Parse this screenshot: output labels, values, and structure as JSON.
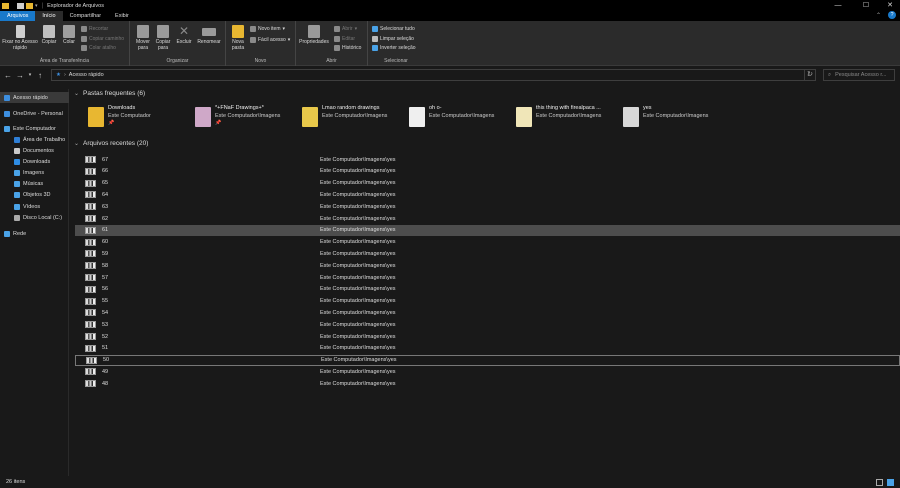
{
  "window": {
    "title": "Explorador de Arquivos",
    "minimize": "—",
    "maximize": "☐",
    "close": "✕"
  },
  "tabs": [
    "Arquivos",
    "Início",
    "Compartilhar",
    "Exibir"
  ],
  "ribbon": {
    "clipboard": {
      "label": "Área de Transferência",
      "pin": "Fixar no Acesso rápido",
      "copy": "Copiar",
      "paste": "Colar",
      "cut": "Recortar",
      "copy_path": "Copiar caminho",
      "paste_shortcut": "Colar atalho"
    },
    "organize": {
      "label": "Organizar",
      "move": "Mover para",
      "copy_to": "Copiar para",
      "delete": "Excluir",
      "rename": "Renomear"
    },
    "new": {
      "label": "Novo",
      "new_folder": "Nova pasta",
      "new_item": "Novo item",
      "easy_access": "Fácil acesso"
    },
    "open": {
      "label": "Abrir",
      "properties": "Propriedades",
      "open": "Abrir",
      "edit": "Editar",
      "history": "Histórico"
    },
    "select": {
      "label": "Selecionar",
      "select_all": "Selecionar tudo",
      "clear": "Limpar seleção",
      "invert": "Inverter seleção"
    }
  },
  "address": {
    "path": "Acesso rápido",
    "search_placeholder": "Pesquisar Acesso r..."
  },
  "nav": [
    {
      "label": "Acesso rápido",
      "color": "#3d8fe0"
    },
    {
      "label": "OneDrive - Personal",
      "color": "#3d8fe0"
    },
    {
      "label": "Este Computador",
      "color": "#4aa3e8"
    },
    {
      "label": "Área de Trabalho",
      "color": "#2f7fd6"
    },
    {
      "label": "Documentos",
      "color": "#c9c9c9"
    },
    {
      "label": "Downloads",
      "color": "#2f8de4"
    },
    {
      "label": "Imagens",
      "color": "#4aa3e8"
    },
    {
      "label": "Músicas",
      "color": "#4aa3e8"
    },
    {
      "label": "Objetos 3D",
      "color": "#4aa3e8"
    },
    {
      "label": "Vídeos",
      "color": "#4aa3e8"
    },
    {
      "label": "Disco Local (C:)",
      "color": "#aaaaaa"
    },
    {
      "label": "Rede",
      "color": "#4aa3e8"
    }
  ],
  "frequent": {
    "header": "Pastas frequentes (6)",
    "items": [
      {
        "name": "Downloads",
        "path": "Este Computador",
        "pin": "📌"
      },
      {
        "name": "*+FNaF Drawings+*",
        "path": "Este Computador\\Imagens",
        "pin": "📌"
      },
      {
        "name": "Lmao random drawings",
        "path": "Este Computador\\Imagens",
        "pin": ""
      },
      {
        "name": "oh o-",
        "path": "Este Computador\\Imagens",
        "pin": ""
      },
      {
        "name": "this thing with firealpaca ...",
        "path": "Este Computador\\Imagens",
        "pin": ""
      },
      {
        "name": "yes",
        "path": "Este Computador\\Imagens",
        "pin": ""
      }
    ]
  },
  "recent": {
    "header": "Arquivos recentes (20)",
    "items": [
      {
        "name": "67",
        "path": "Este Computador\\Imagens\\yes"
      },
      {
        "name": "66",
        "path": "Este Computador\\Imagens\\yes"
      },
      {
        "name": "65",
        "path": "Este Computador\\Imagens\\yes"
      },
      {
        "name": "64",
        "path": "Este Computador\\Imagens\\yes"
      },
      {
        "name": "63",
        "path": "Este Computador\\Imagens\\yes"
      },
      {
        "name": "62",
        "path": "Este Computador\\Imagens\\yes"
      },
      {
        "name": "61",
        "path": "Este Computador\\Imagens\\yes"
      },
      {
        "name": "60",
        "path": "Este Computador\\Imagens\\yes"
      },
      {
        "name": "59",
        "path": "Este Computador\\Imagens\\yes"
      },
      {
        "name": "58",
        "path": "Este Computador\\Imagens\\yes"
      },
      {
        "name": "57",
        "path": "Este Computador\\Imagens\\yes"
      },
      {
        "name": "56",
        "path": "Este Computador\\Imagens\\yes"
      },
      {
        "name": "55",
        "path": "Este Computador\\Imagens\\yes"
      },
      {
        "name": "54",
        "path": "Este Computador\\Imagens\\yes"
      },
      {
        "name": "53",
        "path": "Este Computador\\Imagens\\yes"
      },
      {
        "name": "52",
        "path": "Este Computador\\Imagens\\yes"
      },
      {
        "name": "51",
        "path": "Este Computador\\Imagens\\yes"
      },
      {
        "name": "50",
        "path": "Este Computador\\Imagens\\yes"
      },
      {
        "name": "49",
        "path": "Este Computador\\Imagens\\yes"
      },
      {
        "name": "48",
        "path": "Este Computador\\Imagens\\yes"
      }
    ]
  },
  "status": {
    "count": "26 itens"
  }
}
